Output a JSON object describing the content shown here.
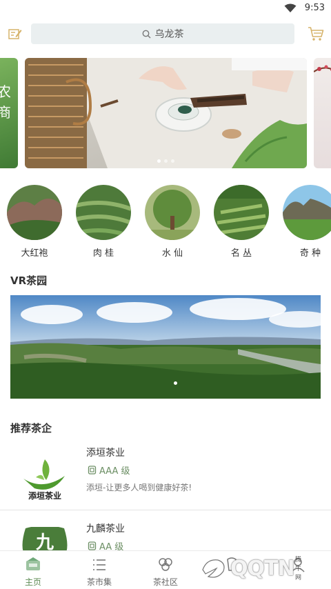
{
  "status_bar": {
    "time": "9:53"
  },
  "header": {
    "search_placeholder": "乌龙茶"
  },
  "banner": {
    "left_text": "农\n商"
  },
  "categories": [
    {
      "name": "大红袍"
    },
    {
      "name": "肉 桂"
    },
    {
      "name": "水 仙"
    },
    {
      "name": "名 丛"
    },
    {
      "name": "奇 种"
    }
  ],
  "vr_section": {
    "title": "VR茶园"
  },
  "recommend_section": {
    "title": "推荐茶企"
  },
  "companies": [
    {
      "name": "添垣茶业",
      "grade": "AAA 级",
      "description": "添垣-让更多人喝到健康好茶!",
      "logo_text": "添垣茶业"
    },
    {
      "name": "九麟茶业",
      "grade": "AA 级",
      "logo_text": "九"
    }
  ],
  "tabbar": {
    "tabs": [
      {
        "label": "主页",
        "icon": "home-icon"
      },
      {
        "label": "茶市集",
        "icon": "list-icon"
      },
      {
        "label": "茶社区",
        "icon": "community-icon"
      },
      {
        "label": "",
        "icon": "tea-icon"
      },
      {
        "label": "",
        "icon": "profile-icon"
      }
    ]
  },
  "watermark": {
    "text": "QQTN",
    "small_text": "腾牛网"
  },
  "colors": {
    "accent": "#5c8a52",
    "grade": "#6b8e63",
    "search_bg": "#eaeff0"
  }
}
